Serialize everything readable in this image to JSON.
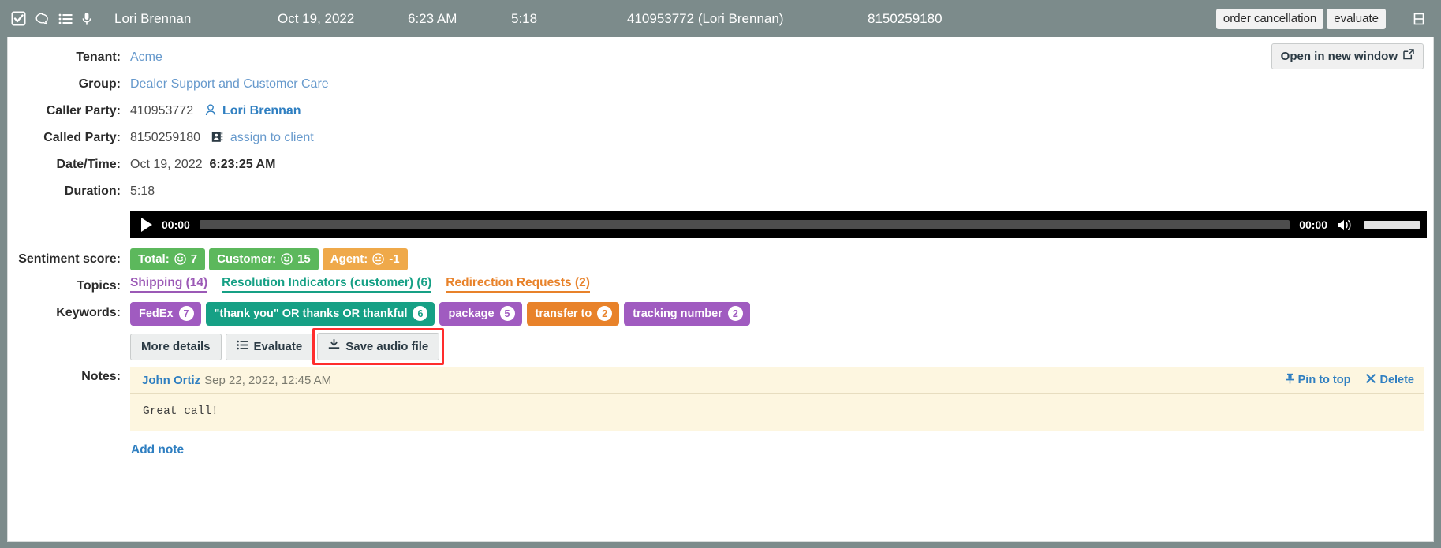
{
  "topbar": {
    "icons": [
      "checkbox-checked-icon",
      "comment-icon",
      "list-icon",
      "microphone-icon"
    ],
    "agent_name": "Lori Brennan",
    "date": "Oct 19, 2022",
    "time": "6:23 AM",
    "duration": "5:18",
    "caller": "410953772 (Lori Brennan)",
    "called": "8150259180",
    "tags": [
      "order cancellation",
      "evaluate"
    ],
    "collapse_icon": "collapse-icon",
    "bg_color": "#7c8b8b"
  },
  "open_in_new_window": {
    "label": "Open in new window",
    "icon": "external-link-icon"
  },
  "details": {
    "tenant_label": "Tenant:",
    "tenant_value": "Acme",
    "group_label": "Group:",
    "group_value": "Dealer Support and Customer Care",
    "caller_party_label": "Caller Party:",
    "caller_party_number": "410953772",
    "caller_party_name": "Lori Brennan",
    "caller_party_icon": "user-icon",
    "called_party_label": "Called Party:",
    "called_party_number": "8150259180",
    "called_party_action": "assign to client",
    "called_party_icon": "assign-client-icon",
    "datetime_label": "Date/Time:",
    "datetime_date": "Oct 19, 2022",
    "datetime_time": "6:23:25 AM",
    "duration_label": "Duration:",
    "duration_value": "5:18"
  },
  "player": {
    "play_icon": "play-icon",
    "current_time": "00:00",
    "total_time": "00:00",
    "volume_icon": "volume-icon",
    "progress_percent": 0,
    "volume_percent": 100
  },
  "sentiment": {
    "label": "Sentiment score:",
    "badges": [
      {
        "name": "Total:",
        "value": "7",
        "face": "smile",
        "color": "#5cb85c"
      },
      {
        "name": "Customer:",
        "value": "15",
        "face": "smile",
        "color": "#5cb85c"
      },
      {
        "name": "Agent:",
        "value": "-1",
        "face": "neutral",
        "color": "#efa94a"
      }
    ]
  },
  "topics": {
    "label": "Topics:",
    "items": [
      {
        "label": "Shipping (14)",
        "color": "#9b59b6"
      },
      {
        "label": "Resolution Indicators (customer) (6)",
        "color": "#16a085"
      },
      {
        "label": "Redirection Requests (2)",
        "color": "#e8822a"
      }
    ]
  },
  "keywords": {
    "label": "Keywords:",
    "items": [
      {
        "label": "FedEx",
        "count": "7",
        "color": "#a05bc0"
      },
      {
        "label": "\"thank you\" OR thanks OR thankful",
        "count": "6",
        "color": "#16a085"
      },
      {
        "label": "package",
        "count": "5",
        "color": "#a05bc0"
      },
      {
        "label": "transfer to",
        "count": "2",
        "color": "#e8822a"
      },
      {
        "label": "tracking number",
        "count": "2",
        "color": "#a05bc0"
      }
    ]
  },
  "actions": {
    "more_details": "More details",
    "evaluate": "Evaluate",
    "evaluate_icon": "list-icon",
    "save_audio": "Save audio file",
    "save_audio_icon": "download-icon",
    "highlight_color": "#ff2d2d"
  },
  "notes": {
    "label": "Notes:",
    "author": "John Ortiz",
    "date": "Sep 22, 2022, 12:45 AM",
    "pin_label": "Pin to top",
    "pin_icon": "pin-icon",
    "delete_label": "Delete",
    "delete_icon": "close-icon",
    "body": "Great call!",
    "add_note": "Add note"
  }
}
